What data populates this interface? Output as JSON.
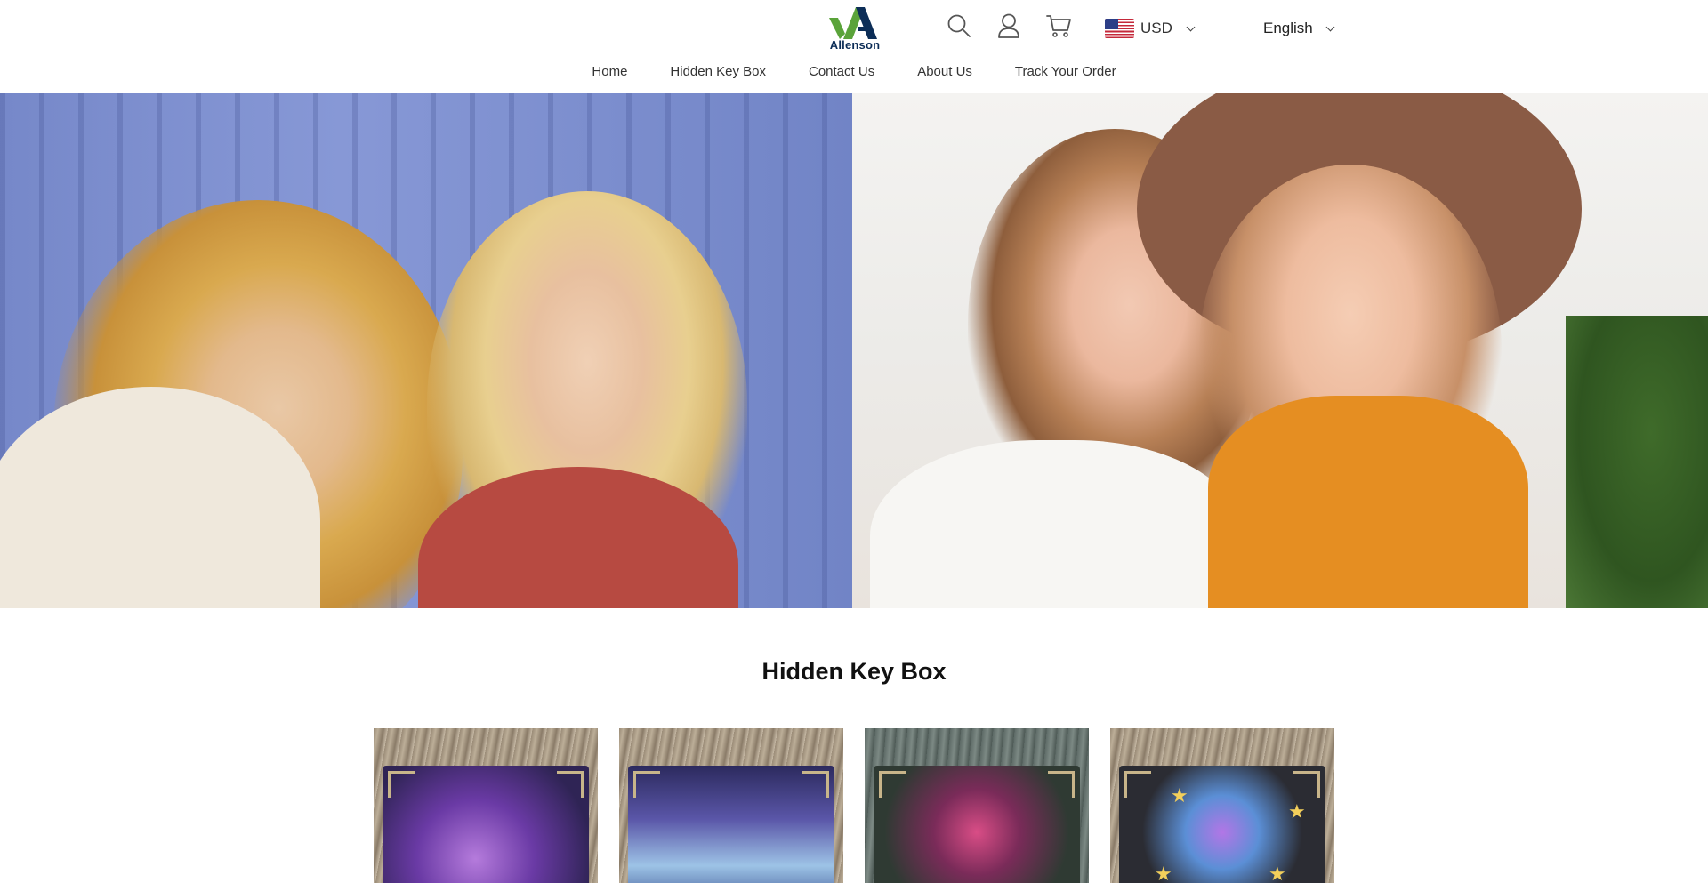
{
  "brand": {
    "logo_text": "Allenson",
    "colors": {
      "logo_green": "#5aa33a",
      "logo_navy": "#0c2d57"
    }
  },
  "header": {
    "icons": [
      "search-icon",
      "account-icon",
      "cart-icon"
    ],
    "currency": {
      "code": "USD",
      "flag": "us-flag-icon"
    },
    "language": {
      "label": "English"
    }
  },
  "nav": {
    "items": [
      {
        "label": "Home"
      },
      {
        "label": "Hidden Key Box"
      },
      {
        "label": "Contact Us"
      },
      {
        "label": "About Us"
      },
      {
        "label": "Track Your Order"
      }
    ]
  },
  "hero": {
    "images": [
      "hero-image-friends-hug",
      "hero-image-friends-laughing"
    ]
  },
  "section": {
    "title": "Hidden Key Box",
    "products": [
      {
        "image": "mushroom-key-box-image"
      },
      {
        "image": "moon-phase-key-box-image"
      },
      {
        "image": "skeleton-hands-key-box-image"
      },
      {
        "image": "crescent-moon-crystal-key-box-image"
      }
    ]
  }
}
